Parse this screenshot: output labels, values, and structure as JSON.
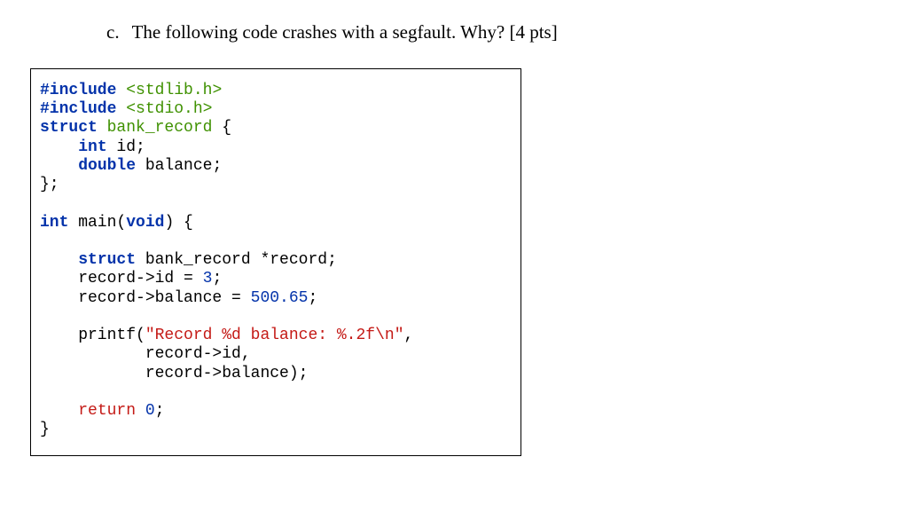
{
  "question": {
    "marker": "c.",
    "text": "The following code crashes with a segfault. Why? [4 pts]"
  },
  "code": {
    "include1_kw": "#include",
    "include1_lib": "<stdlib.h>",
    "include2_kw": "#include",
    "include2_lib": "<stdio.h>",
    "struct_kw": "struct",
    "struct_name": "bank_record",
    "struct_open": " {",
    "int_kw": "int",
    "id_field": " id;",
    "double_kw": "double",
    "balance_field": " balance;",
    "struct_close": "};",
    "int_ret": "int",
    "main_name": " main(",
    "void_kw": "void",
    "main_open": ") {",
    "struct_kw2": "struct",
    "rec_decl": " bank_record *record;",
    "assign_id_pre": "    record->id = ",
    "assign_id_num": "3",
    "assign_id_post": ";",
    "assign_bal_pre": "    record->balance = ",
    "assign_bal_num": "500.65",
    "assign_bal_post": ";",
    "printf_call": "    printf(",
    "printf_str1": "\"Record %d balance: %.2f",
    "printf_esc": "\\n",
    "printf_str2": "\"",
    "printf_comma": ",",
    "printf_arg1": "           record->id,",
    "printf_arg2": "           record->balance);",
    "return_kw": "return",
    "return_val": "0",
    "return_semi": ";",
    "main_close": "}"
  }
}
